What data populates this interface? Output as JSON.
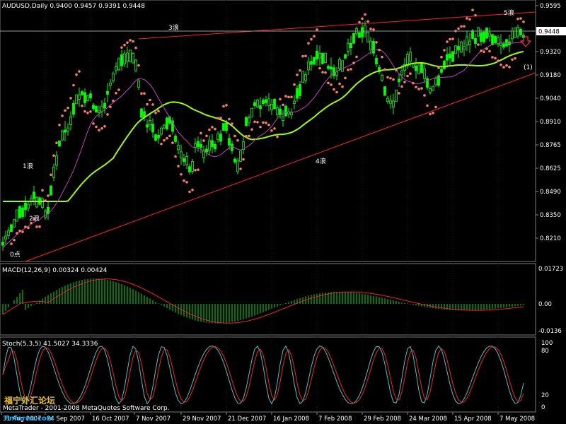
{
  "header": {
    "symbol_line": "AUDUSD,Daily  0.9400 0.9457 0.9391 0.9448",
    "macd_line": "MACD(12,26,9) 0.00324 0.00424",
    "stoch_line": "Stoch(5,3,5) 41.5027 34.3336"
  },
  "price_panel": {
    "current_price": "0.9448",
    "ticks": [
      "0.9595",
      "0.9448",
      "0.9320",
      "0.9180",
      "0.9040",
      "0.8910",
      "0.8765",
      "0.8625",
      "0.8490",
      "0.8350",
      "0.8210"
    ],
    "wave_labels": [
      "0点",
      "1浪",
      "2浪",
      "3浪",
      "4浪",
      "5浪",
      "(1)"
    ]
  },
  "macd_panel": {
    "ticks": [
      "0.01723",
      "0.00",
      "-0.0136"
    ]
  },
  "stoch_panel": {
    "ticks": [
      "100",
      "80",
      "20",
      "0"
    ]
  },
  "time_axis": [
    "31 Aug 2007",
    "24 Sep 2007",
    "16 Oct 2007",
    "7 Nov 2007",
    "29 Nov 2007",
    "21 Dec 2007",
    "16 Jan 2008",
    "7 Feb 2008",
    "29 Feb 2008",
    "24 Mar 2008",
    "15 Apr 2008",
    "7 May 2008"
  ],
  "footer": {
    "copyright": "MetaTrader - 2001-2008 MetaQuotes Software Corp.",
    "watermark_cn": "福宁外汇论坛",
    "watermark_en": "Fnforex.com"
  },
  "colors": {
    "background": "#000000",
    "candles": "#00ff00",
    "ma_slow": "#9aff00",
    "ma_fast": "#c040c0",
    "sar_dots": "#ff7a6a",
    "trendline": "#ff2020",
    "macd_hist": "#00c000",
    "macd_signal": "#ff2020",
    "stoch_main": "#40c8c8",
    "stoch_signal": "#ff2020",
    "arrow": "#ff3030"
  }
}
